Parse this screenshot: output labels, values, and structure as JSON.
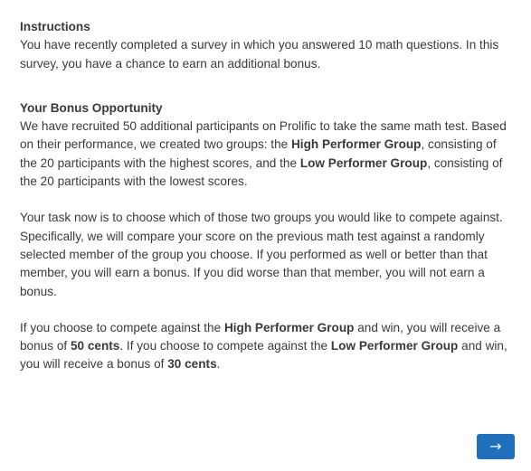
{
  "instructions": {
    "title": "Instructions",
    "text": "You have recently completed a survey in which you answered 10 math questions. In this survey, you have a chance to earn an additional bonus."
  },
  "bonus": {
    "title": "Your Bonus Opportunity",
    "p1_a": "We have recruited 50 additional participants on Prolific to take the same math test. Based on their performance, we created two groups: the ",
    "p1_high": "High Performer Group",
    "p1_b": ", consisting of the 20 participants with the highest scores, and the ",
    "p1_low": "Low Performer Group",
    "p1_c": ", consisting of the 20 participants with the lowest scores.",
    "p2": "Your task now is to choose which of those two groups you would like to compete against. Specifically, we will compare your score on the previous math test against a randomly selected member of the group you choose. If you performed as well or better than that member, you will earn a bonus. If you did worse than that member, you will not earn a bonus.",
    "p3_a": "If you choose to compete against the ",
    "p3_high": "High Performer Group",
    "p3_b": " and win, you will receive a bonus of ",
    "p3_high_amount": "50 cents",
    "p3_c": ". If you choose to compete against the ",
    "p3_low": "Low Performer Group",
    "p3_d": " and win, you will receive a bonus of ",
    "p3_low_amount": "30 cents",
    "p3_e": "."
  },
  "navigation": {
    "next_label": "→"
  },
  "colors": {
    "text": "#3a3a3a",
    "button": "#1f6fbd"
  }
}
